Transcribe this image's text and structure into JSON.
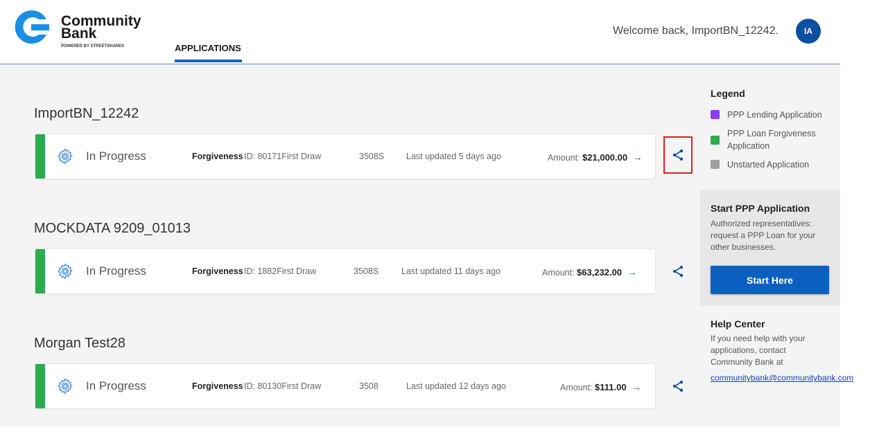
{
  "header": {
    "logo_title": "Community Bank",
    "logo_subtitle": "POWERED BY STREETSHARES",
    "nav_tab": "APPLICATIONS",
    "welcome": "Welcome back, ImportBN_12242.",
    "avatar_initials": "IA"
  },
  "groups": [
    {
      "title": "ImportBN_12242",
      "card": {
        "status": "In Progress",
        "type": "Forgiveness",
        "id_text": "ID: 80171First Draw",
        "code": "3508S",
        "updated": "Last updated 5 days ago",
        "amount_label": "Amount:",
        "amount": "$21,000.00",
        "arrow": "→"
      }
    },
    {
      "title": "MOCKDATA 9209_01013",
      "card": {
        "status": "In Progress",
        "type": "Forgiveness",
        "id_text": "ID: 1882First Draw",
        "code": "3508S",
        "updated": "Last updated 11 days ago",
        "amount_label": "Amount:",
        "amount": "$63,232.00",
        "arrow": "→"
      }
    },
    {
      "title": "Morgan Test28",
      "card": {
        "status": "In Progress",
        "type": "Forgiveness",
        "id_text": "ID: 80130First Draw",
        "code": "3508",
        "updated": "Last updated 12 days ago",
        "amount_label": "Amount:",
        "amount": "$111.00",
        "arrow": "→"
      }
    }
  ],
  "legend": {
    "heading": "Legend",
    "items": [
      {
        "label": "PPP Lending Application",
        "color": "#8b3df5"
      },
      {
        "label": "PPP Loan Forgiveness Application",
        "color": "#2eaa4f"
      },
      {
        "label": "Unstarted Application",
        "color": "#9e9e9e"
      }
    ]
  },
  "start_ppp": {
    "heading": "Start PPP Application",
    "text": "Authorized representatives: request a PPP Loan for your other businesses.",
    "button": "Start Here"
  },
  "help_center": {
    "heading": "Help Center",
    "text": "If you need help with your applications, contact Community Bank at",
    "email": "communitybank@communitybank.com"
  },
  "colors": {
    "accent": "#1a5fb4",
    "status_bar": "#2eaa4f",
    "highlight": "#e31b1b"
  },
  "icons": {
    "logo": "community-bank-logo-icon",
    "status": "gear-icon",
    "share": "share-icon"
  }
}
